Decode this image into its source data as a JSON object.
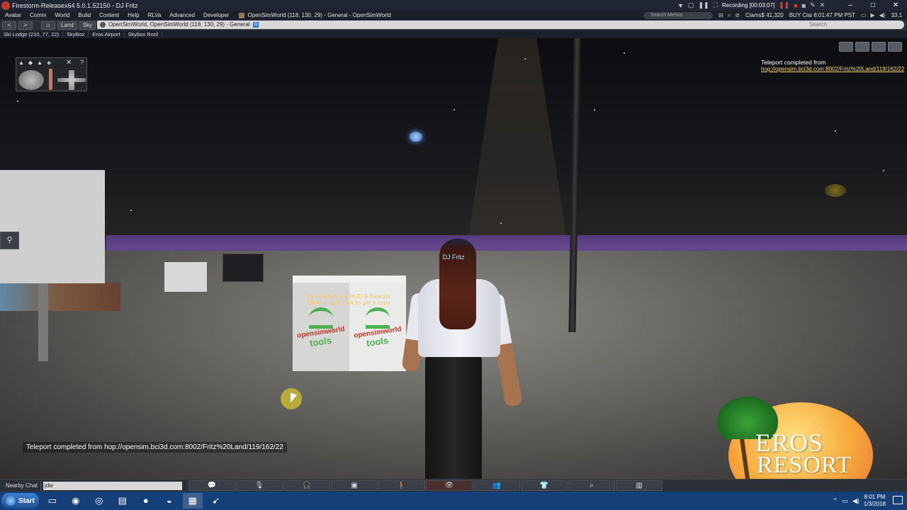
{
  "window": {
    "title": "Firestorm-Releasex64 5.0.1.52150 - DJ Fritz",
    "recording_label": "Recording [00:03:07]",
    "controls": {
      "minimize": "–",
      "maximize": "□",
      "close": "✕"
    }
  },
  "menubar": {
    "items": [
      "Avatar",
      "Comm",
      "World",
      "Build",
      "Content",
      "Help",
      "RLVa",
      "Advanced",
      "Developer"
    ],
    "region": "OpenSimWorld (118, 130, 29) - General - OpenSimWorld",
    "search_menus_placeholder": "Search Menus",
    "balance": "Clams$ 41,320",
    "buy_time": "BUY Clai 8:01:47 PM PST",
    "fps": "33.1"
  },
  "navbar": {
    "back": "<",
    "forward": ">",
    "home": "⌂",
    "land": "Land",
    "sky": "Sky",
    "location": "OpenSimWorld, OpenSimWorld (118, 130, 29) - General",
    "rating": "G",
    "search_placeholder": "Search"
  },
  "favorites": [
    "Ski Lodge (210, 77, 22)",
    "SkyBox",
    "Eros Airport",
    "Skybox Roof"
  ],
  "scene": {
    "avatar_name": "DJ Fritz",
    "object_hover_text_line1": "OpenSimWorld HUD & Beacon",
    "object_hover_text_line2": "Click or right click to get a copy",
    "cube_brand": "opensimworld",
    "cube_word": "tools"
  },
  "camera_widget": {
    "close": "✕",
    "help": "?"
  },
  "toast": {
    "title": "Teleport completed from",
    "link": "hop://opensim.bci3d.com:8002/Fritz%20Land/119/162/22"
  },
  "chat_overlay": "Teleport completed from hop://opensim.bci3d.com:8002/Fritz%20Land/119/162/22",
  "logo": {
    "line1": "EROS",
    "line2": "RESORT"
  },
  "toolbar": {
    "nearby_chat_label": "Nearby Chat",
    "chat_input_value": "jdw",
    "buttons": [
      "chat-bubble",
      "voice",
      "headset",
      "square",
      "walk",
      "eye",
      "people",
      "shirt",
      "search",
      "map"
    ]
  },
  "taskbar": {
    "start_label": "Start",
    "clock_time": "8:01 PM",
    "clock_date": "1/3/2018"
  }
}
